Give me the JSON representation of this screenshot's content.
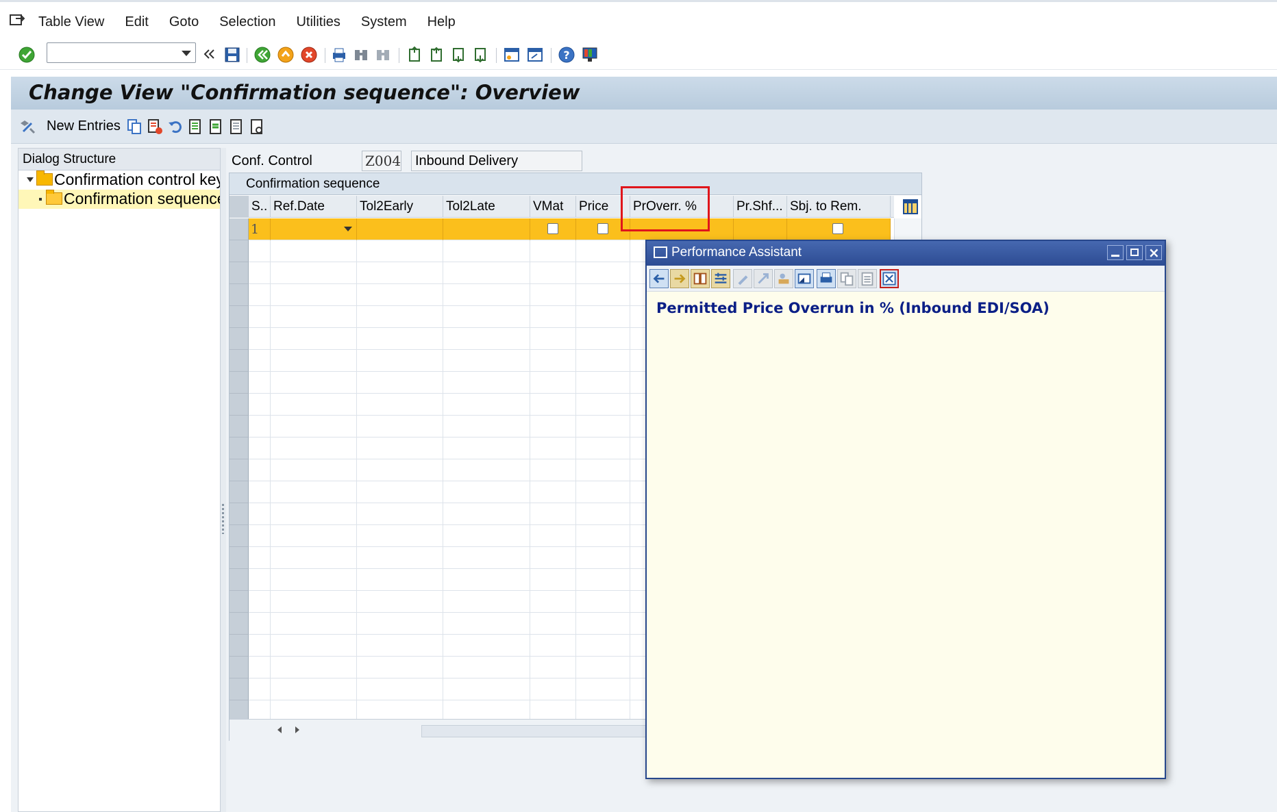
{
  "menu": {
    "items": [
      "Table View",
      "Edit",
      "Goto",
      "Selection",
      "Utilities",
      "System",
      "Help"
    ]
  },
  "toolbar": {
    "command_value": "",
    "icons": [
      "enter-icon",
      "save-icon",
      "back-icon",
      "exit-icon",
      "cancel-icon",
      "print-icon",
      "find-icon",
      "find-next-icon",
      "first-page-icon",
      "previous-page-icon",
      "next-page-icon",
      "last-page-icon",
      "create-session-icon",
      "shortcut-icon",
      "help-icon",
      "layout-icon"
    ]
  },
  "title": "Change View \"Confirmation sequence\": Overview",
  "app_toolbar": {
    "new_entries": "New Entries"
  },
  "dialog_structure": {
    "header": "Dialog Structure",
    "items": [
      {
        "label": "Confirmation control key",
        "level": 0
      },
      {
        "label": "Confirmation sequence",
        "level": 1
      }
    ]
  },
  "conf_control": {
    "label": "Conf. Control",
    "value": "Z004",
    "description": "Inbound Delivery"
  },
  "table": {
    "caption": "Confirmation sequence",
    "columns": [
      "S..",
      "Ref.Date",
      "Tol2Early",
      "Tol2Late",
      "VMat",
      "Price",
      "PrOverr. %",
      "Pr.Shf...",
      "Sbj. to Rem."
    ],
    "rows": [
      {
        "seq": "1",
        "ref_date": "",
        "tol_early": "",
        "tol_late": "",
        "vmat": false,
        "price": false,
        "proverr": "",
        "prshf": "",
        "sbj_rem": false
      }
    ]
  },
  "performance_assistant": {
    "title": "Performance Assistant",
    "heading": "Permitted Price Overrun in % (Inbound EDI/SOA)"
  },
  "colors": {
    "highlight_row": "#fbbf1c",
    "title_bg": "#c5d6e7",
    "popup_title": "#2d4c93",
    "popup_text": "#0b1f86",
    "callout_red": "#e0151b"
  }
}
